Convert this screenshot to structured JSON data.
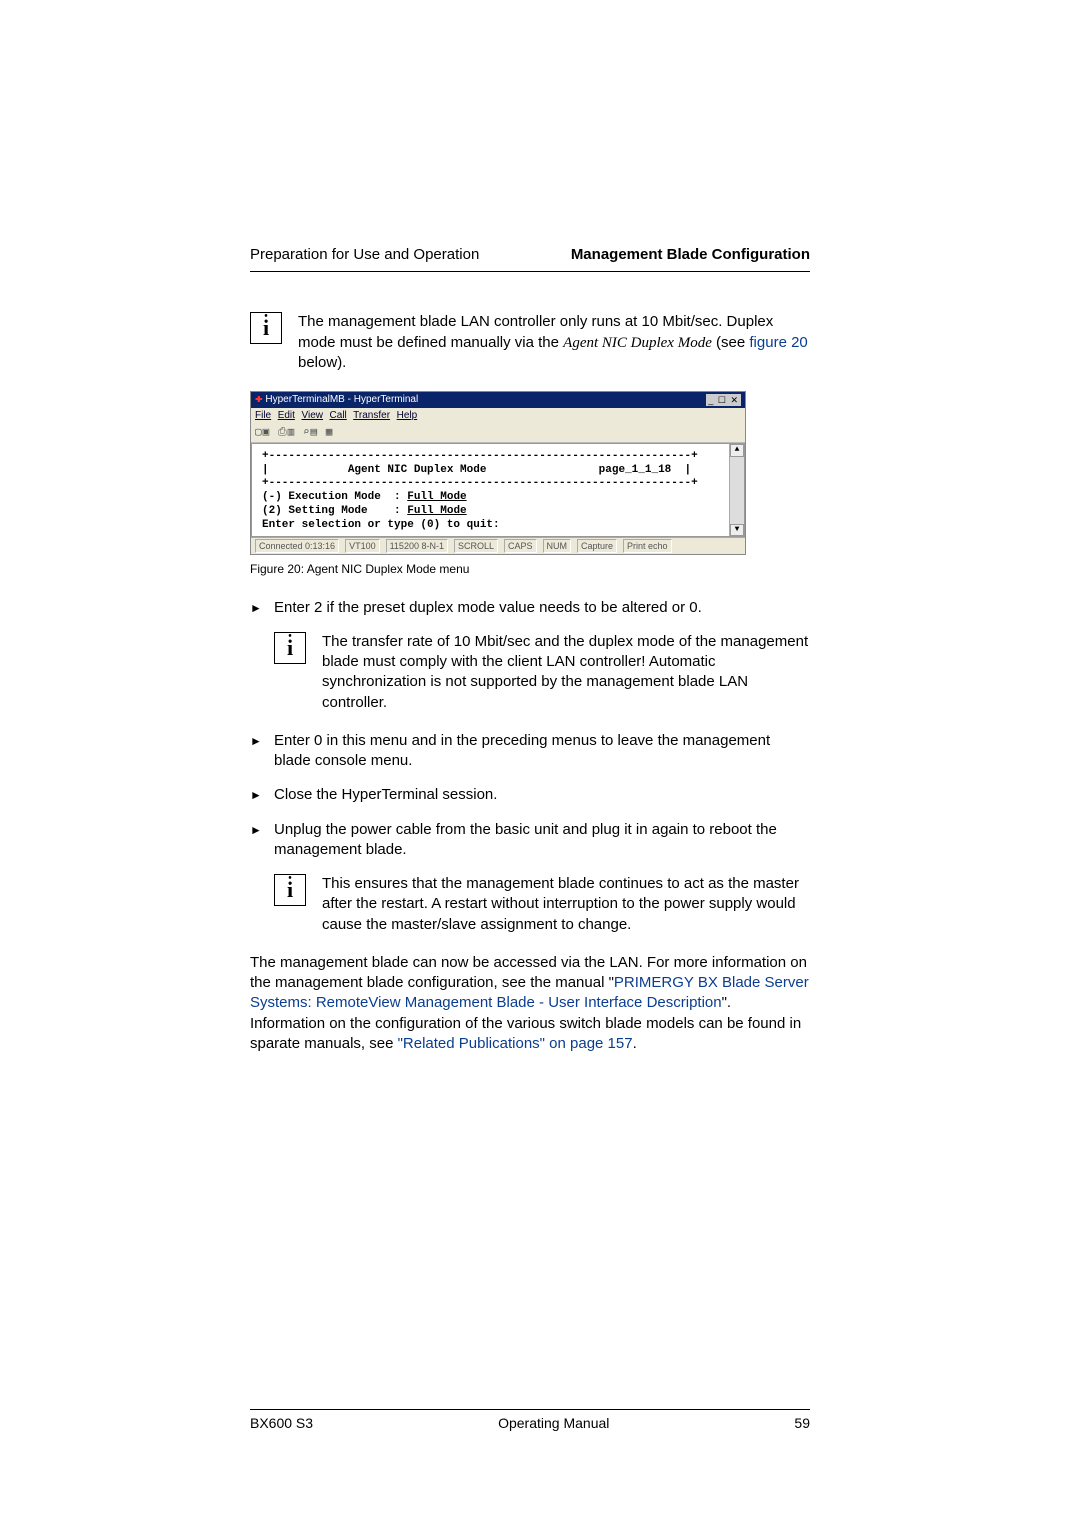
{
  "header": {
    "left": "Preparation for Use and Operation",
    "right": "Management Blade Configuration"
  },
  "info1": {
    "line1": "The management blade LAN controller only runs at 10 Mbit/sec. Duplex mode must be defined manually via the ",
    "italic": "Agent NIC Duplex Mode",
    "line2_fragment": " (see ",
    "link": "figure 20",
    "line2_after": " below)."
  },
  "figure": {
    "title": "HyperTerminalMB - HyperTerminal",
    "menu": {
      "file": "File",
      "edit": "Edit",
      "view": "View",
      "call": "Call",
      "transfer": "Transfer",
      "help": "Help"
    },
    "term": {
      "header": "Agent NIC Duplex Mode",
      "page": "page_1_1_18",
      "row1_left": "(-) Execution Mode  : ",
      "row1_val": "Full Mode",
      "row2_left": "(2) Setting Mode    : ",
      "row2_val": "Full Mode",
      "prompt": "Enter selection or type (0) to quit:"
    },
    "status": {
      "conn": "Connected 0:13:16",
      "emu": "VT100",
      "baud": "115200 8-N-1",
      "s1": "SCROLL",
      "s2": "CAPS",
      "s3": "NUM",
      "s4": "Capture",
      "s5": "Print echo"
    },
    "caption": "Figure 20: Agent NIC Duplex Mode menu"
  },
  "bullets": {
    "b1": "Enter 2 if the preset duplex mode value needs to be altered or 0.",
    "info2": "The transfer rate of 10 Mbit/sec and the duplex mode of the management blade must comply with the client LAN controller! Automatic synchronization is not supported by the management blade LAN controller.",
    "b2": "Enter 0 in this menu and in the preceding menus to leave the management blade console menu.",
    "b3": "Close the HyperTerminal session.",
    "b4": "Unplug the power cable from the basic unit and plug it in again to reboot the management blade.",
    "info3": "This ensures that the management blade continues to act as the master after the restart. A restart without interruption to the power supply would cause the master/slave assignment to change."
  },
  "closing": {
    "p1a": "The management blade can now be accessed via the LAN. For more information on the management blade configuration, see the manual \"",
    "link1": "PRIMERGY BX Blade Server Systems: RemoteView Management Blade - User Interface Description",
    "p1b": "\". Information on the configuration of the various switch blade models can be found in sparate manuals, see ",
    "link2": "\"Related Publications\" on page 157",
    "p1c": "."
  },
  "footer": {
    "left": "BX600 S3",
    "center": "Operating Manual",
    "right": "59"
  }
}
